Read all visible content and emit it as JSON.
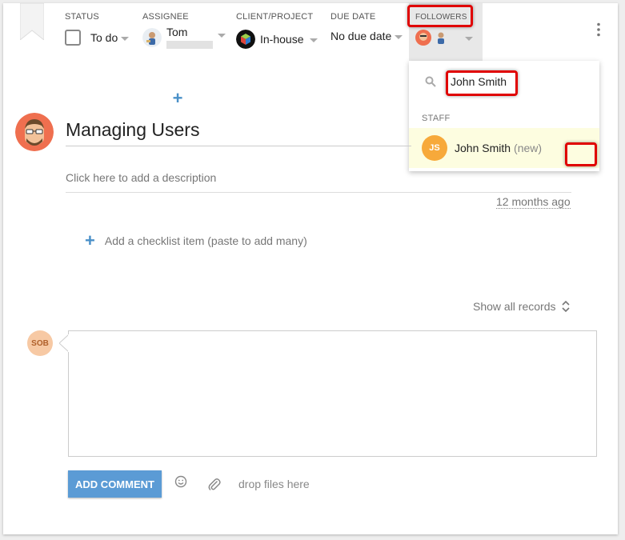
{
  "header": {
    "status_label": "STATUS",
    "status_value": "To do",
    "assignee_label": "ASSIGNEE",
    "assignee_value": "Tom",
    "client_label": "CLIENT/PROJECT",
    "client_value": "In-house",
    "due_label": "DUE DATE",
    "due_value": "No due date",
    "followers_label": "FOLLOWERS"
  },
  "followers_dropdown": {
    "search_value": "John Smith",
    "section_label": "STAFF",
    "items": [
      {
        "initials": "JS",
        "name": "John Smith",
        "tag": "(new)"
      }
    ]
  },
  "task": {
    "title": "Managing Users",
    "description_placeholder": "Click here to add a description",
    "timestamp": "12 months ago",
    "checklist_placeholder": "Add a checklist item (paste to add many)",
    "show_all": "Show all records"
  },
  "comment": {
    "user_initials": "SOB",
    "submit_label": "ADD COMMENT",
    "drop_text": "drop files here"
  },
  "colors": {
    "accent": "#5b9bd5",
    "highlight": "#e00000",
    "js_avatar": "#f7a93a",
    "sob_avatar": "#f7c9a4",
    "staff_row_bg": "#fdfde0"
  }
}
